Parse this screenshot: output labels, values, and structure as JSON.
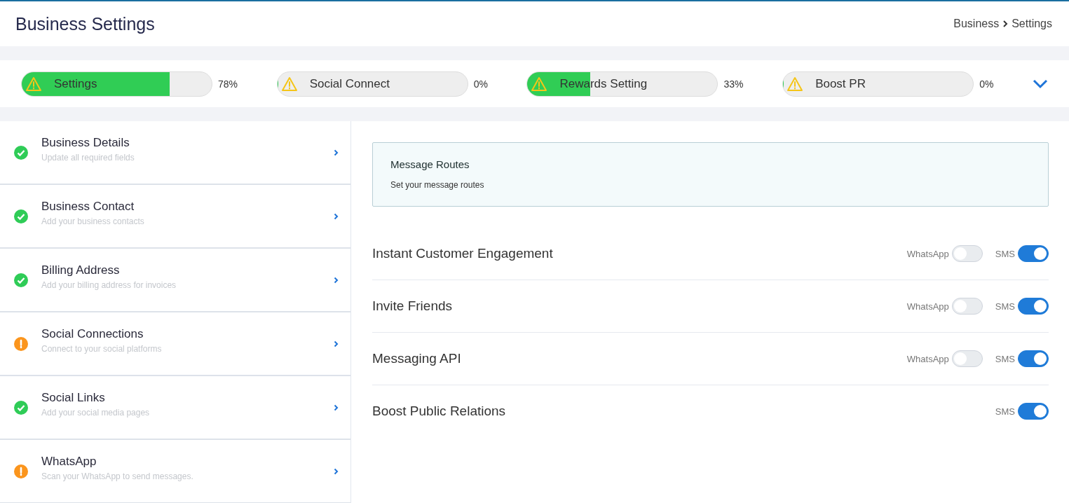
{
  "page": {
    "title": "Business Settings",
    "breadcrumb": [
      "Business",
      "Settings"
    ]
  },
  "progress": [
    {
      "label": "Settings",
      "level": 0.78,
      "reading": "78%"
    },
    {
      "label": "Social Connect",
      "level": 0,
      "reading": "0%"
    },
    {
      "label": "Rewards Setting",
      "level": 0.33,
      "reading": "33%"
    },
    {
      "label": "Boost PR",
      "level": 0,
      "reading": "0%"
    }
  ],
  "sidebar": {
    "items": [
      {
        "title": "Business Details",
        "subtitle": "Update all required fields",
        "kind": "done"
      },
      {
        "title": "Business Contact",
        "subtitle": "Add your business contacts",
        "kind": "done"
      },
      {
        "title": "Billing Address",
        "subtitle": "Add your billing address for invoices",
        "kind": "done"
      },
      {
        "title": "Social Connections",
        "subtitle": "Connect to your social platforms",
        "kind": "warning"
      },
      {
        "title": "Social Links",
        "subtitle": "Add your social media pages",
        "kind": "done"
      },
      {
        "title": "WhatsApp",
        "subtitle": "Scan your WhatsApp to send messages.",
        "kind": "warning"
      }
    ]
  },
  "info": {
    "title": "Message Routes",
    "text": "Set your message routes"
  },
  "routes": [
    {
      "name": "Instant Customer Engagement",
      "toggles": [
        {
          "label": "WhatsApp",
          "on": false
        },
        {
          "label": "SMS",
          "on": true
        }
      ]
    },
    {
      "name": "Invite Friends",
      "toggles": [
        {
          "label": "WhatsApp",
          "on": false
        },
        {
          "label": "SMS",
          "on": true
        }
      ]
    },
    {
      "name": "Messaging API",
      "toggles": [
        {
          "label": "WhatsApp",
          "on": false
        },
        {
          "label": "SMS",
          "on": true
        }
      ]
    },
    {
      "name": "Boost Public Relations",
      "toggles": [
        {
          "label": "SMS",
          "on": true
        }
      ]
    }
  ]
}
